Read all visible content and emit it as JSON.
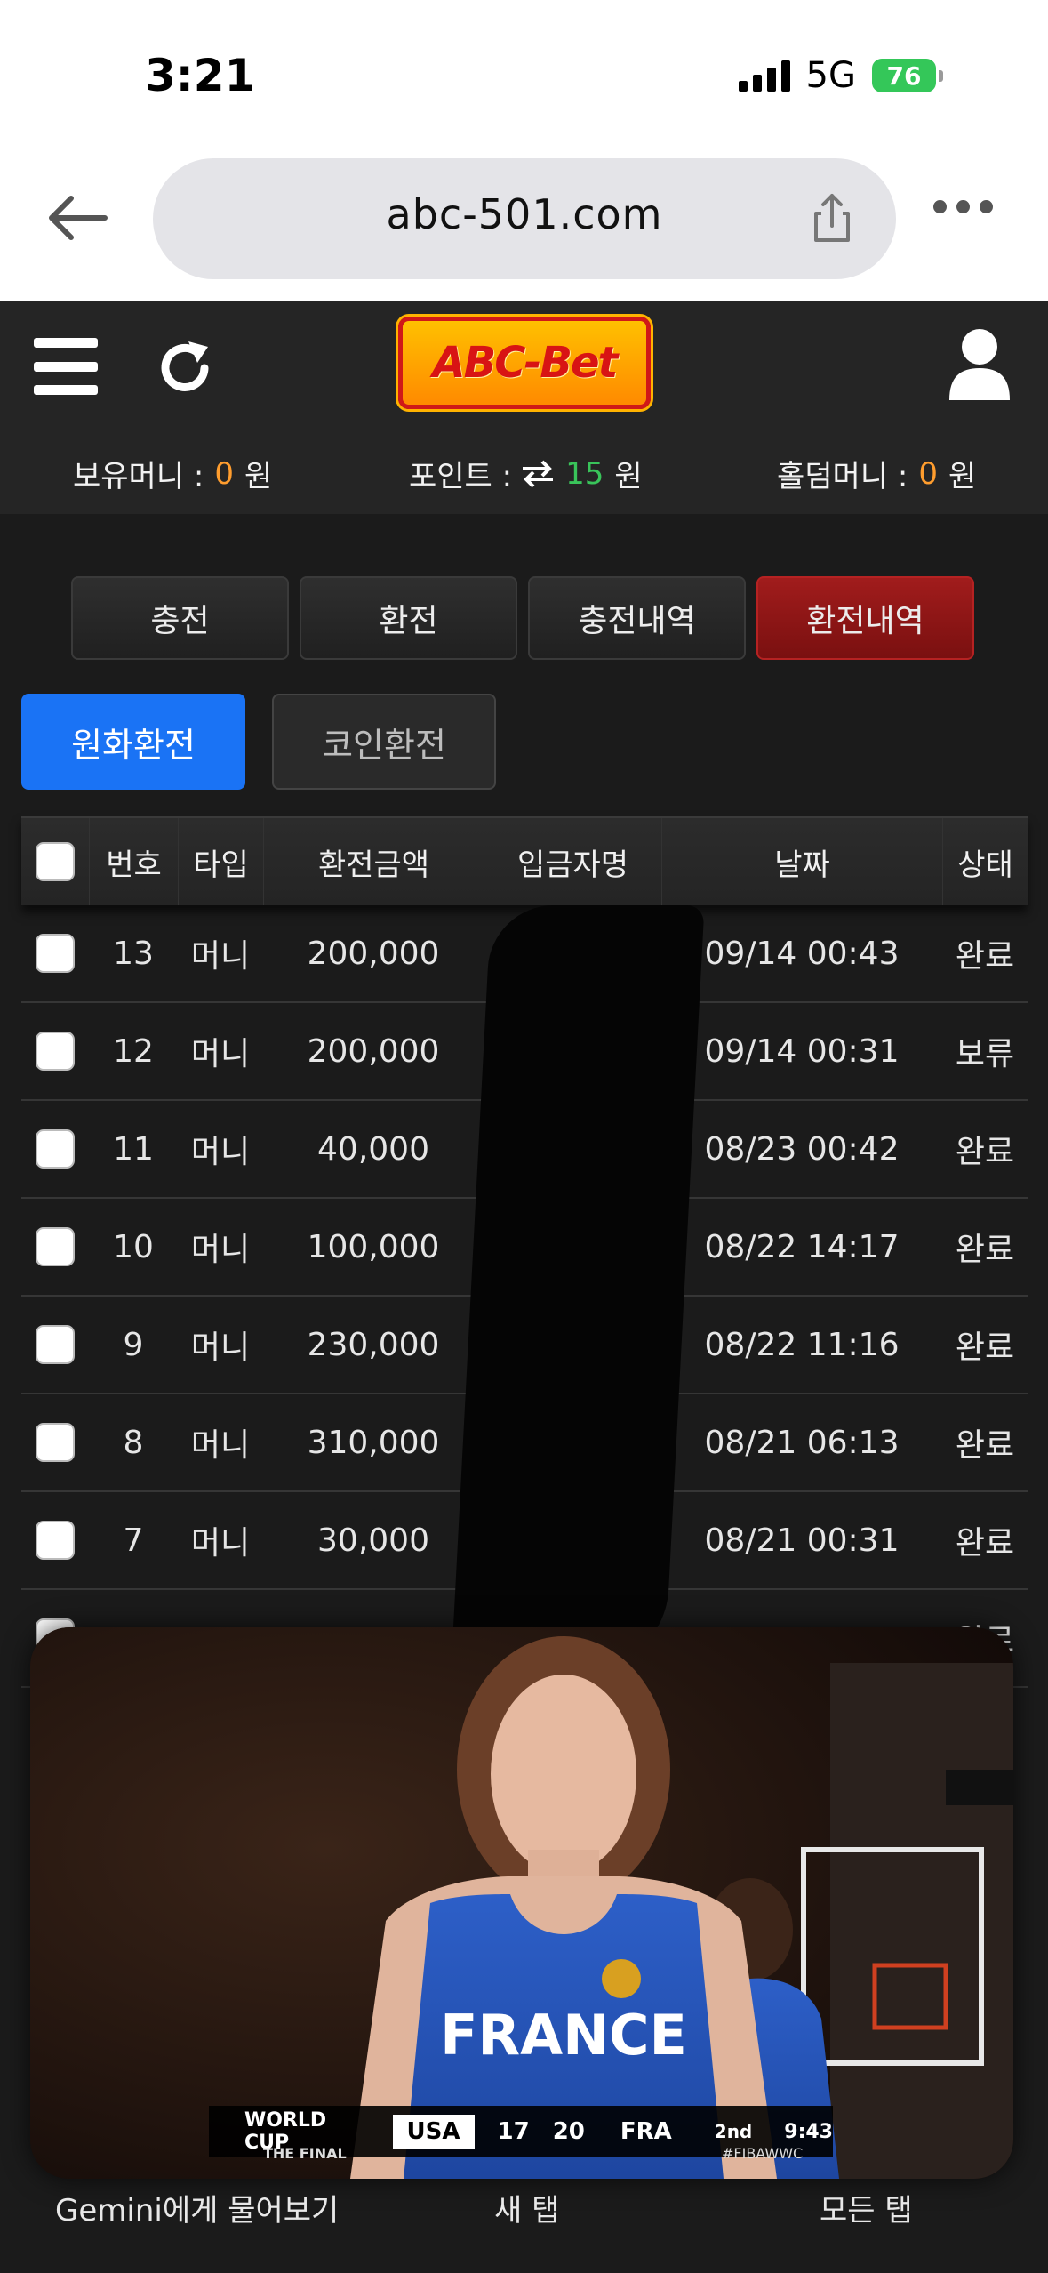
{
  "status_bar": {
    "time": "3:21",
    "network": "5G",
    "battery": "76"
  },
  "browser": {
    "url": "abc-501.com"
  },
  "site": {
    "logo": "ABC-Bet",
    "balances": [
      {
        "label": "보유머니 :",
        "value": "0",
        "unit": "원"
      },
      {
        "label": "포인트 :",
        "value": "15",
        "unit": "원"
      },
      {
        "label": "홀덤머니 :",
        "value": "0",
        "unit": "원"
      }
    ],
    "tabs": [
      "충전",
      "환전",
      "충전내역",
      "환전내역"
    ],
    "active_tab": "환전내역",
    "sub_tabs": [
      "원화환전",
      "코인환전"
    ],
    "active_sub_tab": "원화환전",
    "table": {
      "headers": [
        "번호",
        "타입",
        "환전금액",
        "입금자명",
        "날짜",
        "상태"
      ],
      "rows": [
        {
          "no": "13",
          "type": "머니",
          "amount": "200,000",
          "date": "09/14 00:43",
          "status": "완료"
        },
        {
          "no": "12",
          "type": "머니",
          "amount": "200,000",
          "date": "09/14 00:31",
          "status": "보류"
        },
        {
          "no": "11",
          "type": "머니",
          "amount": "40,000",
          "date": "08/23 00:42",
          "status": "완료"
        },
        {
          "no": "10",
          "type": "머니",
          "amount": "100,000",
          "date": "08/22 14:17",
          "status": "완료"
        },
        {
          "no": "9",
          "type": "머니",
          "amount": "230,000",
          "date": "08/22 11:16",
          "status": "완료"
        },
        {
          "no": "8",
          "type": "머니",
          "amount": "310,000",
          "date": "08/21 06:13",
          "status": "완료"
        },
        {
          "no": "7",
          "type": "머니",
          "amount": "30,000",
          "date": "08/21 00:31",
          "status": "완료"
        },
        {
          "no": "",
          "type": "",
          "amount": "",
          "date": "",
          "status": "완료"
        }
      ]
    }
  },
  "pip_video": {
    "jersey": "FRANCE",
    "scoreboard": {
      "event": "WORLD CUP",
      "subtitle": "THE FINAL",
      "team1": "USA",
      "score1": "17",
      "score2": "20",
      "team2": "FRA",
      "period": "2nd",
      "clock": "9:43",
      "hashtag": "#FIBAWWC"
    }
  },
  "bottom_toolbar": {
    "left": "Gemini에게 물어보기",
    "center": "새 탭",
    "right": "모든 탭"
  }
}
